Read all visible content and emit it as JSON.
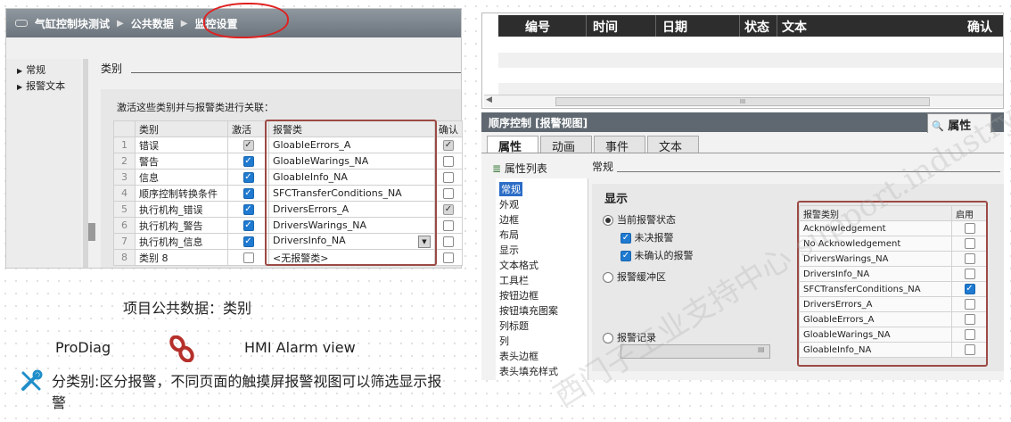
{
  "left": {
    "breadcrumb": [
      "气缸控制块测试",
      "公共数据",
      "监控设置"
    ],
    "nav_items": [
      "常规",
      "报警文本"
    ],
    "section_title": "类别",
    "assoc_text": "激活这些类别并与报警类进行关联：",
    "table": {
      "headers": [
        "",
        "类别",
        "激活",
        "报警类",
        "确认"
      ],
      "rows": [
        {
          "n": "1",
          "category": "错误",
          "active": "grey",
          "class": "GloableErrors_A",
          "ack": true
        },
        {
          "n": "2",
          "category": "警告",
          "active": "on",
          "class": "GloableWarings_NA",
          "ack": false
        },
        {
          "n": "3",
          "category": "信息",
          "active": "on",
          "class": "GloableInfo_NA",
          "ack": false
        },
        {
          "n": "4",
          "category": "顺序控制转换条件",
          "active": "on",
          "class": "SFCTransferConditions_NA",
          "ack": false
        },
        {
          "n": "5",
          "category": "执行机构_错误",
          "active": "on",
          "class": "DriversErrors_A",
          "ack": true
        },
        {
          "n": "6",
          "category": "执行机构_警告",
          "active": "on",
          "class": "DriversWarings_NA",
          "ack": false
        },
        {
          "n": "7",
          "category": "执行机构_信息",
          "active": "on",
          "class": "DriversInfo_NA",
          "ack": false
        },
        {
          "n": "8",
          "category": "类别 8",
          "active": "off",
          "class": "<无报警类>",
          "ack": false
        }
      ]
    }
  },
  "captions": {
    "project_data": "项目公共数据：类别",
    "prodiag": "ProDiag",
    "hmi_view": "HMI Alarm view",
    "description": "分类别:区分报警，不同页面的触摸屏报警视图可以筛选显示报警"
  },
  "alarm_view": {
    "headers": [
      "编号",
      "时间",
      "日期",
      "状态",
      "文本",
      "确认"
    ],
    "scroll_mark": "III"
  },
  "properties": {
    "title": "顺序控制 [报警视图]",
    "props_tab": "属性",
    "tabs": [
      "属性",
      "动画",
      "事件",
      "文本"
    ],
    "list_title": "属性列表",
    "list_items": [
      "常规",
      "外观",
      "边框",
      "布局",
      "显示",
      "文本格式",
      "工具栏",
      "按钮边框",
      "按钮填充图案",
      "列标题",
      "列",
      "表头边框",
      "表头填充样式"
    ],
    "general": "常规",
    "show": "显示",
    "options": {
      "current_state": "当前报警状态",
      "unresolved": "未决报警",
      "unacked": "未确认的报警",
      "buffer": "报警缓冲区",
      "log": "报警记录"
    },
    "class_table": {
      "headers": [
        "报警类别",
        "启用"
      ],
      "rows": [
        {
          "name": "Acknowledgement",
          "enabled": false
        },
        {
          "name": "No Acknowledgement",
          "enabled": false
        },
        {
          "name": "DriversWarings_NA",
          "enabled": false
        },
        {
          "name": "DriversInfo_NA",
          "enabled": false
        },
        {
          "name": "SFCTransferConditions_NA",
          "enabled": true
        },
        {
          "name": "DriversErrors_A",
          "enabled": false
        },
        {
          "name": "GloableErrors_A",
          "enabled": false
        },
        {
          "name": "GloableWarings_NA",
          "enabled": false
        },
        {
          "name": "GloableInfo_NA",
          "enabled": false
        }
      ]
    },
    "watermark": "西门子工业支持中心 support.industry.siemens.com"
  }
}
